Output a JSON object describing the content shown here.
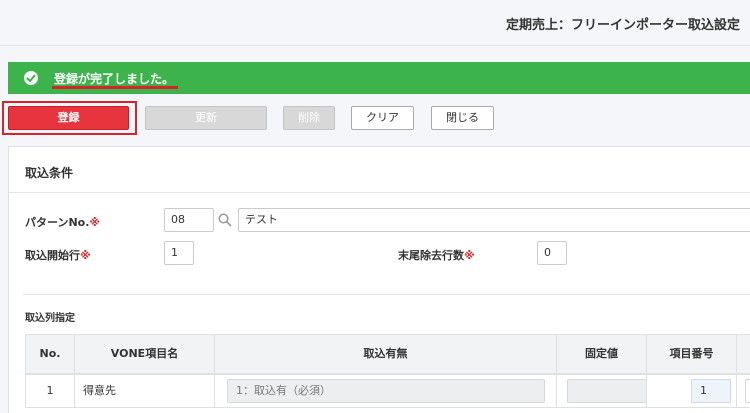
{
  "header": {
    "title": "定期売上：フリーインポーター取込設定"
  },
  "alert": {
    "message": "登録が完了しました。"
  },
  "toolbar": {
    "register_label": "登録",
    "update_label": "更新",
    "delete_label": "削除",
    "clear_label": "クリア",
    "close_label": "閉じる"
  },
  "conditions": {
    "title": "取込条件",
    "pattern_label": "パターンNo.",
    "required_mark": "※",
    "pattern_no": "08",
    "pattern_name": "テスト",
    "start_row_label": "取込開始行",
    "start_row": "1",
    "trailing_rows_label": "末尾除去行数",
    "trailing_rows": "0"
  },
  "columns_section": {
    "title": "取込列指定",
    "headers": [
      "No.",
      "VONE項目名",
      "取込有無",
      "固定値",
      "項目番号"
    ],
    "rows": [
      {
        "no": "1",
        "item_name": "得意先",
        "import_flag": "1：取込有（必須）",
        "fixed_value": "",
        "item_number": "1"
      }
    ]
  },
  "colors": {
    "success": "#3cb44b",
    "primary": "#e8343c",
    "required": "#d8232a"
  },
  "icons": {
    "alert": "check-circle-icon",
    "search": "search-icon"
  }
}
